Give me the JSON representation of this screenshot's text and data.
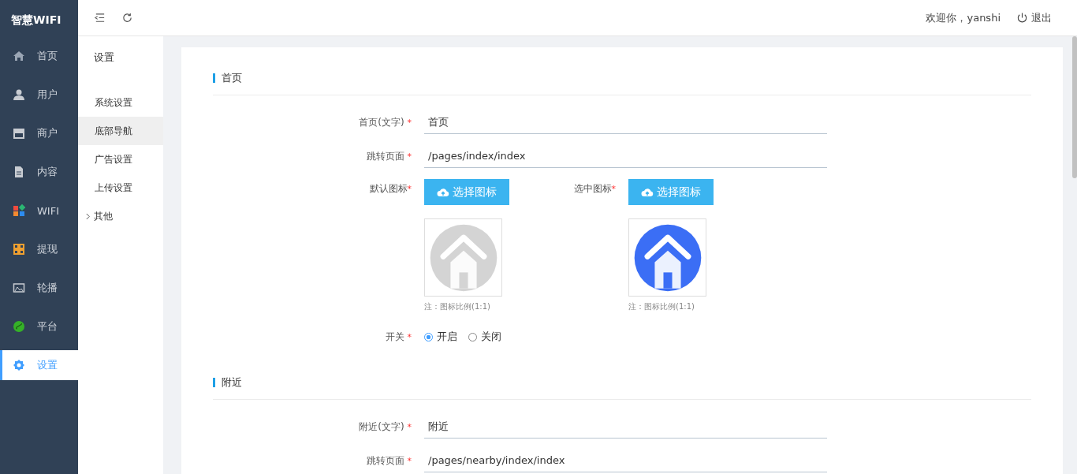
{
  "brand": "智慧WIFI",
  "nav": [
    {
      "label": "首页",
      "selected": false
    },
    {
      "label": "用户",
      "selected": false
    },
    {
      "label": "商户",
      "selected": false
    },
    {
      "label": "内容",
      "selected": false
    },
    {
      "label": "WIFI",
      "selected": false
    },
    {
      "label": "提现",
      "selected": false
    },
    {
      "label": "轮播",
      "selected": false
    },
    {
      "label": "平台",
      "selected": false
    },
    {
      "label": "设置",
      "selected": true
    }
  ],
  "submenu": {
    "title": "设置",
    "items": [
      {
        "label": "系统设置",
        "selected": false,
        "expandable": false
      },
      {
        "label": "底部导航",
        "selected": true,
        "expandable": false
      },
      {
        "label": "广告设置",
        "selected": false,
        "expandable": false
      },
      {
        "label": "上传设置",
        "selected": false,
        "expandable": false
      },
      {
        "label": "其他",
        "selected": false,
        "expandable": true
      }
    ]
  },
  "header": {
    "welcome": "欢迎你，yanshi",
    "logout": "退出"
  },
  "sections": [
    {
      "title": "首页",
      "fields": [
        {
          "kind": "text",
          "label": "首页(文字)",
          "required_mark": "*",
          "value": "首页"
        },
        {
          "kind": "text",
          "label": "跳转页面",
          "required_mark": "*",
          "value": "/pages/index/index"
        },
        {
          "kind": "icons",
          "items": [
            {
              "label": "默认图标",
              "required_mark": "*",
              "button": "选择图标",
              "note": "注：图标比例(1:1)",
              "color": "#d4d4d4"
            },
            {
              "label": "选中图标",
              "required_mark": "*",
              "button": "选择图标",
              "note": "注：图标比例(1:1)",
              "color": "#3b6ef5"
            }
          ]
        },
        {
          "kind": "radio",
          "label": "开关",
          "required_mark": "*",
          "options": [
            {
              "label": "开启",
              "selected": true
            },
            {
              "label": "关闭",
              "selected": false
            }
          ]
        }
      ]
    },
    {
      "title": "附近",
      "fields": [
        {
          "kind": "text",
          "label": "附近(文字)",
          "required_mark": "*",
          "value": "附近"
        },
        {
          "kind": "text",
          "label": "跳转页面",
          "required_mark": "*",
          "value": "/pages/nearby/index/index"
        }
      ]
    }
  ]
}
